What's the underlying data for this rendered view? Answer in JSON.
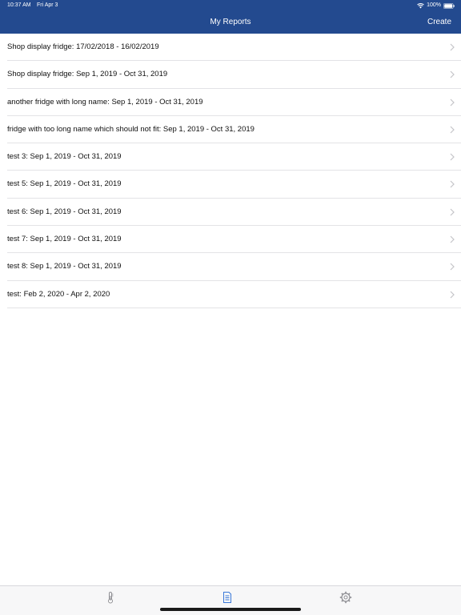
{
  "status_bar": {
    "time": "10:37 AM",
    "date": "Fri Apr 3",
    "battery": "100%"
  },
  "nav": {
    "title": "My Reports",
    "create_label": "Create"
  },
  "reports": [
    "Shop display fridge: 17/02/2018 - 16/02/2019",
    "Shop display fridge: Sep 1, 2019 - Oct 31, 2019",
    "another fridge with long name: Sep 1, 2019 - Oct 31, 2019",
    "fridge with too long name which should not fit: Sep 1, 2019 - Oct 31, 2019",
    "test 3: Sep 1, 2019 - Oct 31, 2019",
    "test 5: Sep 1, 2019 - Oct 31, 2019",
    "test 6: Sep 1, 2019 - Oct 31, 2019",
    "test 7: Sep 1, 2019 - Oct 31, 2019",
    "test 8: Sep 1, 2019 - Oct 31, 2019",
    "test: Feb 2, 2020 - Apr 2, 2020"
  ],
  "tabs": [
    {
      "icon": "thermometer-icon",
      "active": false
    },
    {
      "icon": "document-icon",
      "active": true
    },
    {
      "icon": "gear-icon",
      "active": false
    }
  ],
  "colors": {
    "header_bg": "#234a8f",
    "active_tab": "#3a78d8",
    "inactive_tab": "#8e8e93",
    "separator": "#e3e3e6"
  }
}
